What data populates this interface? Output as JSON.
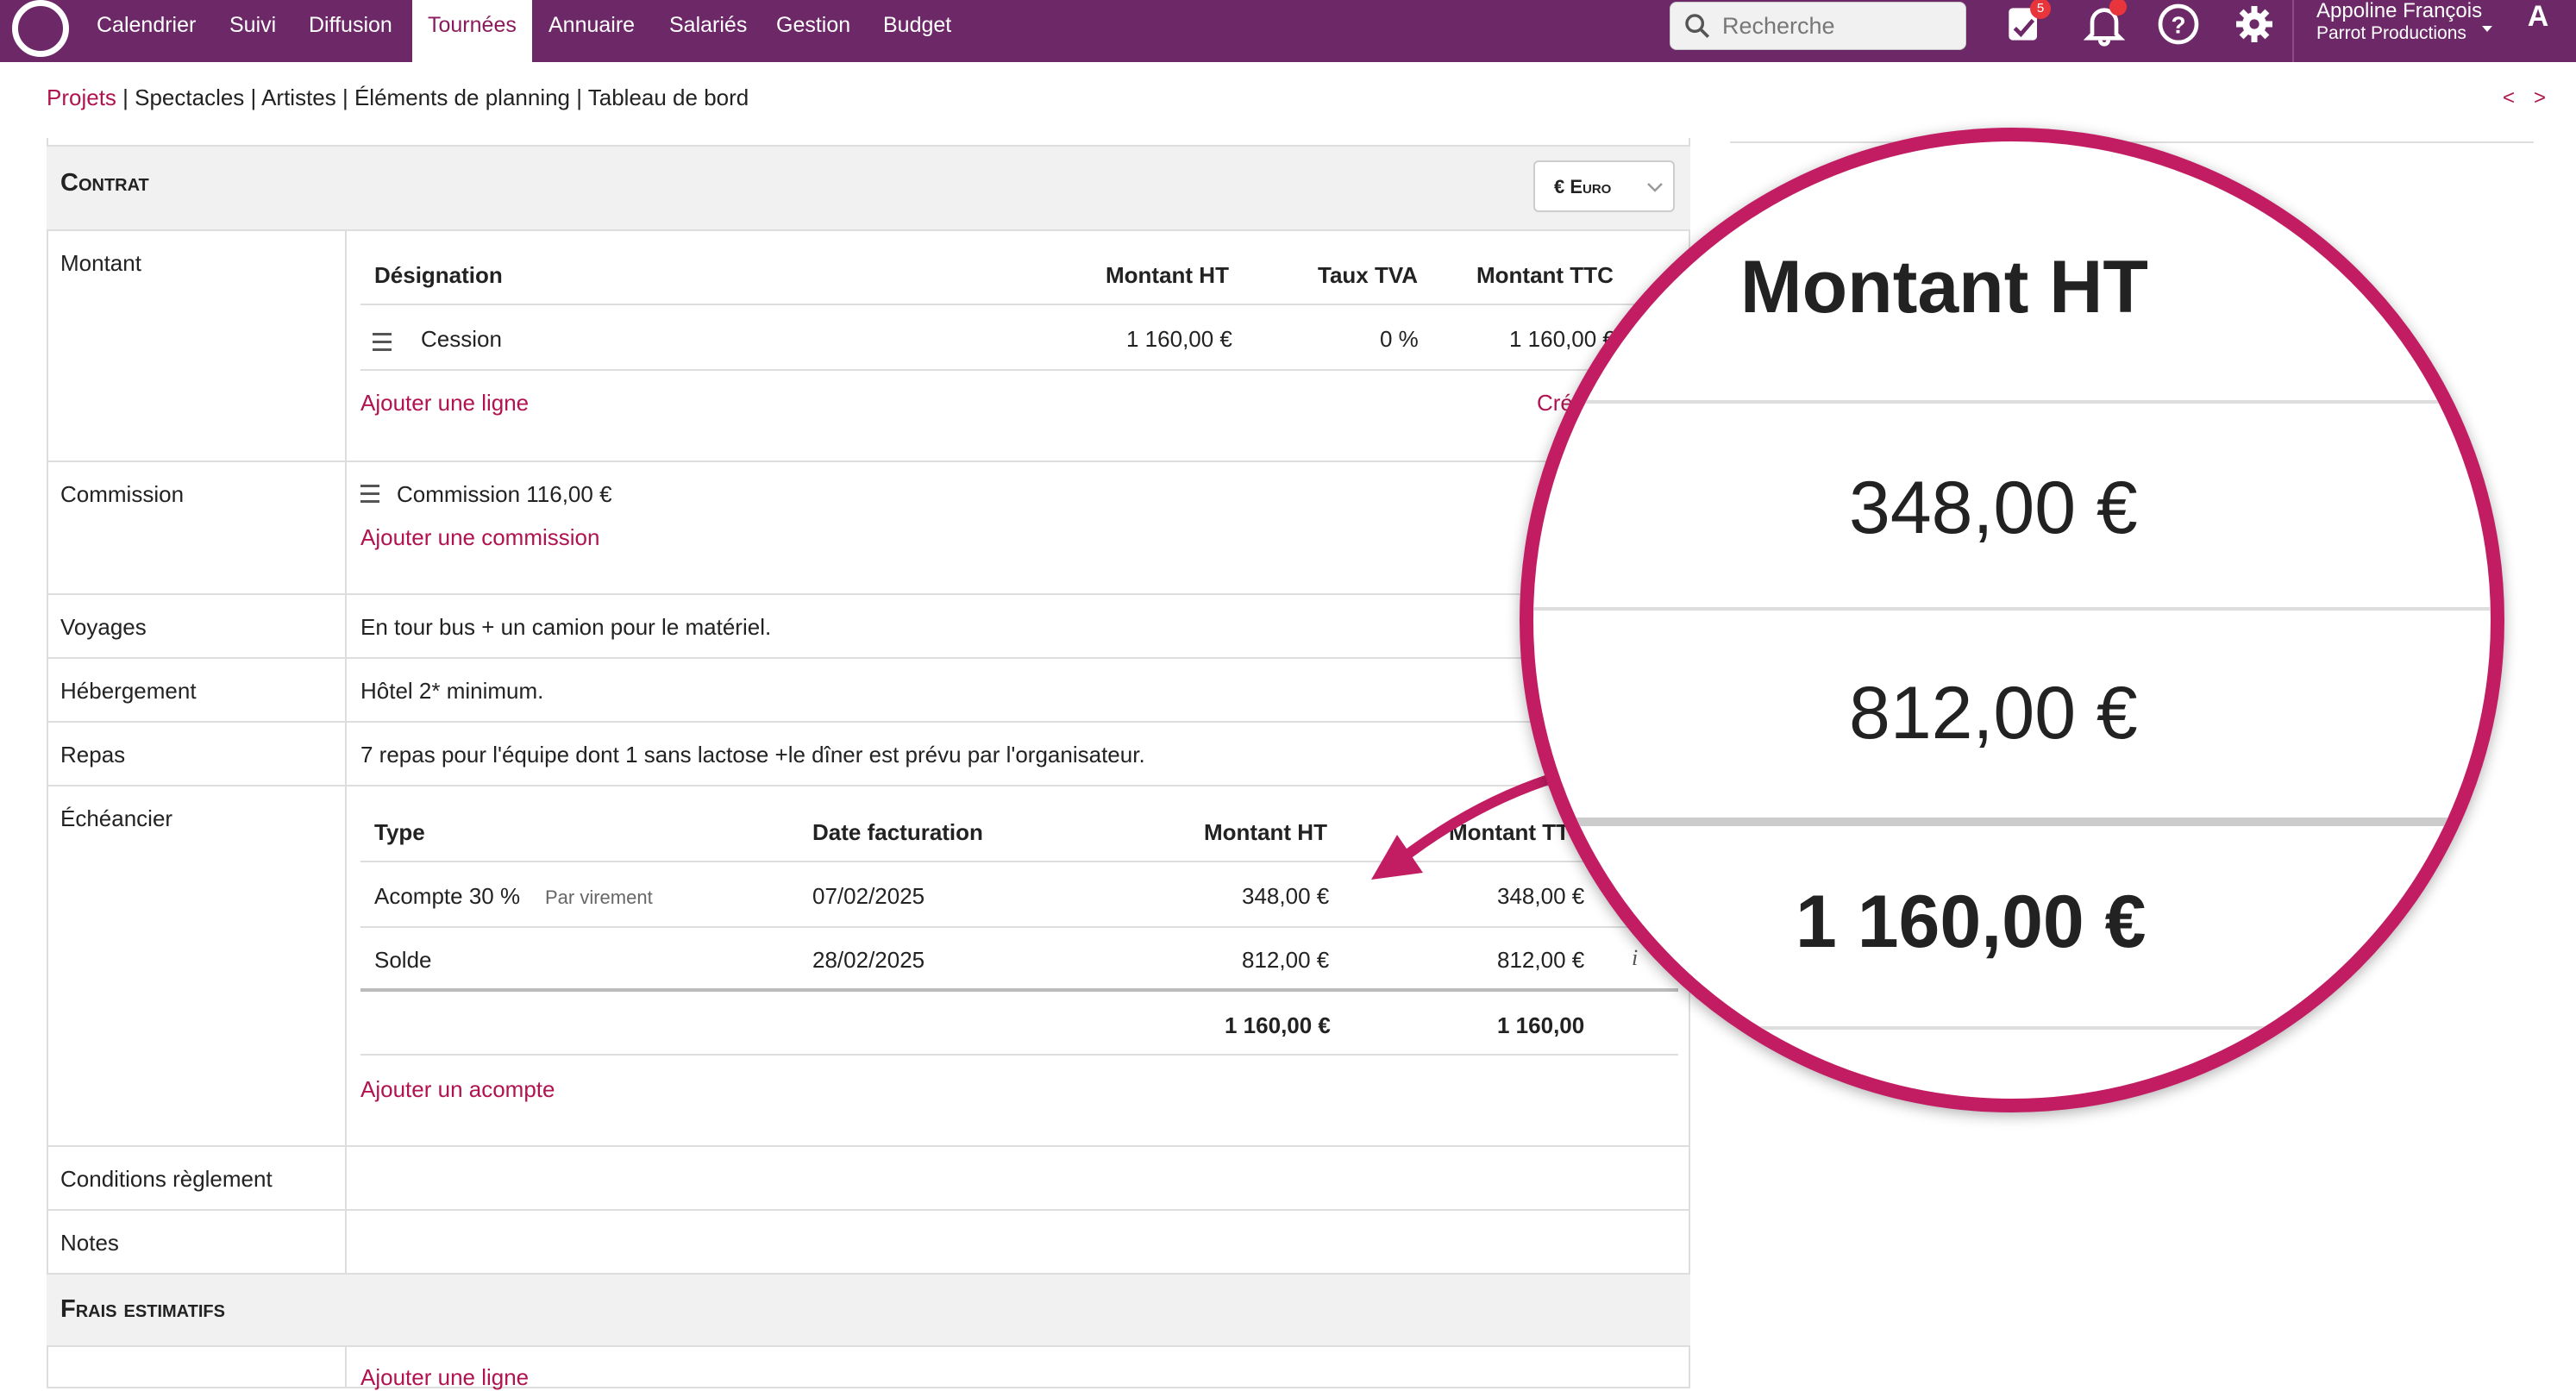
{
  "nav": {
    "items": [
      "Calendrier",
      "Suivi",
      "Diffusion",
      "Tournées",
      "Annuaire",
      "Salariés",
      "Gestion",
      "Budget"
    ],
    "active": "Tournées"
  },
  "search": {
    "placeholder": "Recherche"
  },
  "toolbar": {
    "tasks_badge": "5"
  },
  "user": {
    "name": "Appoline François",
    "company": "Parrot Productions",
    "avatar": "A"
  },
  "breadcrumb": {
    "active": "Projets",
    "rest": " | Spectacles | Artistes | Éléments de planning | Tableau de bord"
  },
  "pager": {
    "prev": "<",
    "next": ">"
  },
  "contract": {
    "title": "Contrat",
    "currency": "€ Euro",
    "montant": {
      "label": "Montant",
      "headers": [
        "Désignation",
        "Montant HT",
        "Taux TVA",
        "Montant TTC"
      ],
      "row": {
        "designation": "Cession",
        "ht": "1 160,00 €",
        "tva": "0 %",
        "ttc": "1 160,00 €"
      },
      "add_link": "Ajouter une ligne",
      "extra_link": "Cré"
    },
    "commission": {
      "label": "Commission",
      "value": "Commission 116,00 €",
      "add_link": "Ajouter une commission"
    },
    "voyages": {
      "label": "Voyages",
      "value": "En tour bus + un camion pour le matériel."
    },
    "hebergement": {
      "label": "Hébergement",
      "value": "Hôtel 2* minimum."
    },
    "repas": {
      "label": "Repas",
      "value": "7 repas pour l'équipe dont 1 sans lactose +le dîner est prévu par l'organisateur."
    },
    "echeancier": {
      "label": "Échéancier",
      "headers": [
        "Type",
        "Date facturation",
        "Montant HT",
        "Montant TTC"
      ],
      "rows": [
        {
          "type": "Acompte 30 %",
          "mode": "Par virement",
          "date": "07/02/2025",
          "ht": "348,00 €",
          "ttc": "348,00 €"
        },
        {
          "type": "Solde",
          "mode": "",
          "date": "28/02/2025",
          "ht": "812,00 €",
          "ttc": "812,00 €"
        }
      ],
      "total_ht": "1 160,00 €",
      "total_ttc": "1 160,00",
      "info": "i",
      "add_link": "Ajouter un acompte"
    },
    "conditions": {
      "label": "Conditions règlement"
    },
    "notes": {
      "label": "Notes"
    }
  },
  "frais": {
    "title": "Frais estimatifs",
    "add_link": "Ajouter une ligne"
  },
  "zoom": {
    "header": "Montant HT",
    "values": [
      "348,00 €",
      "812,00 €",
      "1 160,00 €"
    ]
  },
  "colors": {
    "brand": "#6d2868",
    "accent": "#b0134f",
    "zoom_ring": "#c21d63"
  }
}
